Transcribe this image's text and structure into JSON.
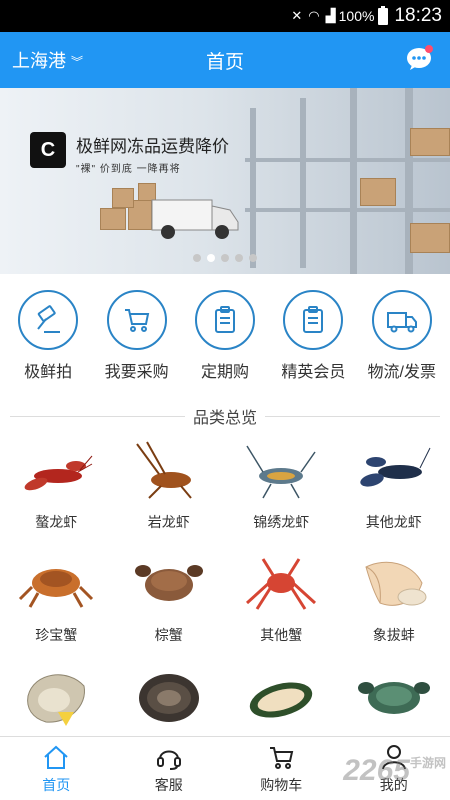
{
  "status_bar": {
    "battery": "100%",
    "time": "18:23"
  },
  "header": {
    "city": "上海港",
    "title": "首页"
  },
  "banner": {
    "headline": "极鲜网冻品运费降价",
    "subline": "\"裸\" 价到底 一降再将",
    "dots": 5,
    "active_dot": 1
  },
  "quick_actions": [
    {
      "label": "极鲜拍",
      "icon": "gavel-icon"
    },
    {
      "label": "我要采购",
      "icon": "cart-icon"
    },
    {
      "label": "定期购",
      "icon": "clipboard-icon"
    },
    {
      "label": "精英会员",
      "icon": "clipboard-icon"
    },
    {
      "label": "物流/发票",
      "icon": "truck-icon"
    }
  ],
  "section_title": "品类总览",
  "categories": [
    {
      "label": "螯龙虾",
      "icon": "lobster-image"
    },
    {
      "label": "岩龙虾",
      "icon": "rock-lobster-image"
    },
    {
      "label": "锦绣龙虾",
      "icon": "painted-lobster-image"
    },
    {
      "label": "其他龙虾",
      "icon": "blue-lobster-image"
    },
    {
      "label": "珍宝蟹",
      "icon": "dungeness-crab-image"
    },
    {
      "label": "棕蟹",
      "icon": "brown-crab-image"
    },
    {
      "label": "其他蟹",
      "icon": "king-crab-image"
    },
    {
      "label": "象拔蚌",
      "icon": "geoduck-image"
    },
    {
      "label": "",
      "icon": "oyster-image"
    },
    {
      "label": "",
      "icon": "abalone-image"
    },
    {
      "label": "",
      "icon": "mussel-image"
    },
    {
      "label": "",
      "icon": "mud-crab-image"
    }
  ],
  "tabs": [
    {
      "label": "首页",
      "icon": "home-icon",
      "active": true
    },
    {
      "label": "客服",
      "icon": "headset-icon",
      "active": false
    },
    {
      "label": "购物车",
      "icon": "cart-icon",
      "active": false
    },
    {
      "label": "我的",
      "icon": "user-icon",
      "active": false
    }
  ],
  "watermark": {
    "brand": "2265",
    "suffix": "手游网"
  },
  "colors": {
    "primary": "#2196f3",
    "icon_stroke": "#2a84c6",
    "badge": "#ff4d6d"
  }
}
